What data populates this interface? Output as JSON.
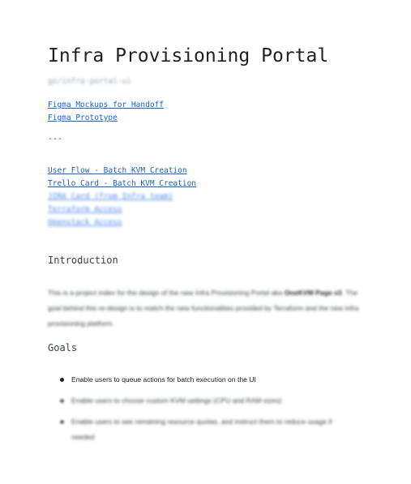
{
  "document": {
    "title": "Infra Provisioning Portal",
    "subtitle": "go/infra-portal-ui",
    "links_primary": [
      {
        "label": "Figma Mockups for Handoff"
      },
      {
        "label": "Figma Prototype"
      }
    ],
    "divider": "---",
    "links_secondary": [
      {
        "label": "User Flow - Batch KVM Creation",
        "blurred": false
      },
      {
        "label": "Trello Card - Batch KVM Creation",
        "blurred": false
      },
      {
        "label": "JIRA Card (from Infra team)",
        "blurred": true
      },
      {
        "label": "Terraform Access",
        "blurred": true
      },
      {
        "label": "Openstack Access",
        "blurred": true
      }
    ],
    "introduction": {
      "heading": "Introduction",
      "text_before": "This is a project index for the design of the new Infra Provisioning Portal aka ",
      "text_bold": "OneKVM Page v3",
      "text_after": ". The goal behind this re-design is to match the new functionalities provided by Terraform and the new infra provisioning platform."
    },
    "goals": {
      "heading": "Goals",
      "items": [
        {
          "text": "Enable users to queue actions for batch execution on the UI",
          "blurred": false
        },
        {
          "text": "Enable users to choose custom KVM settings (CPU and RAM sizes)",
          "blurred": true
        },
        {
          "text": "Enable users to see remaining resource quotas, and instruct them to reduce usage if needed",
          "blurred": true
        }
      ]
    }
  }
}
